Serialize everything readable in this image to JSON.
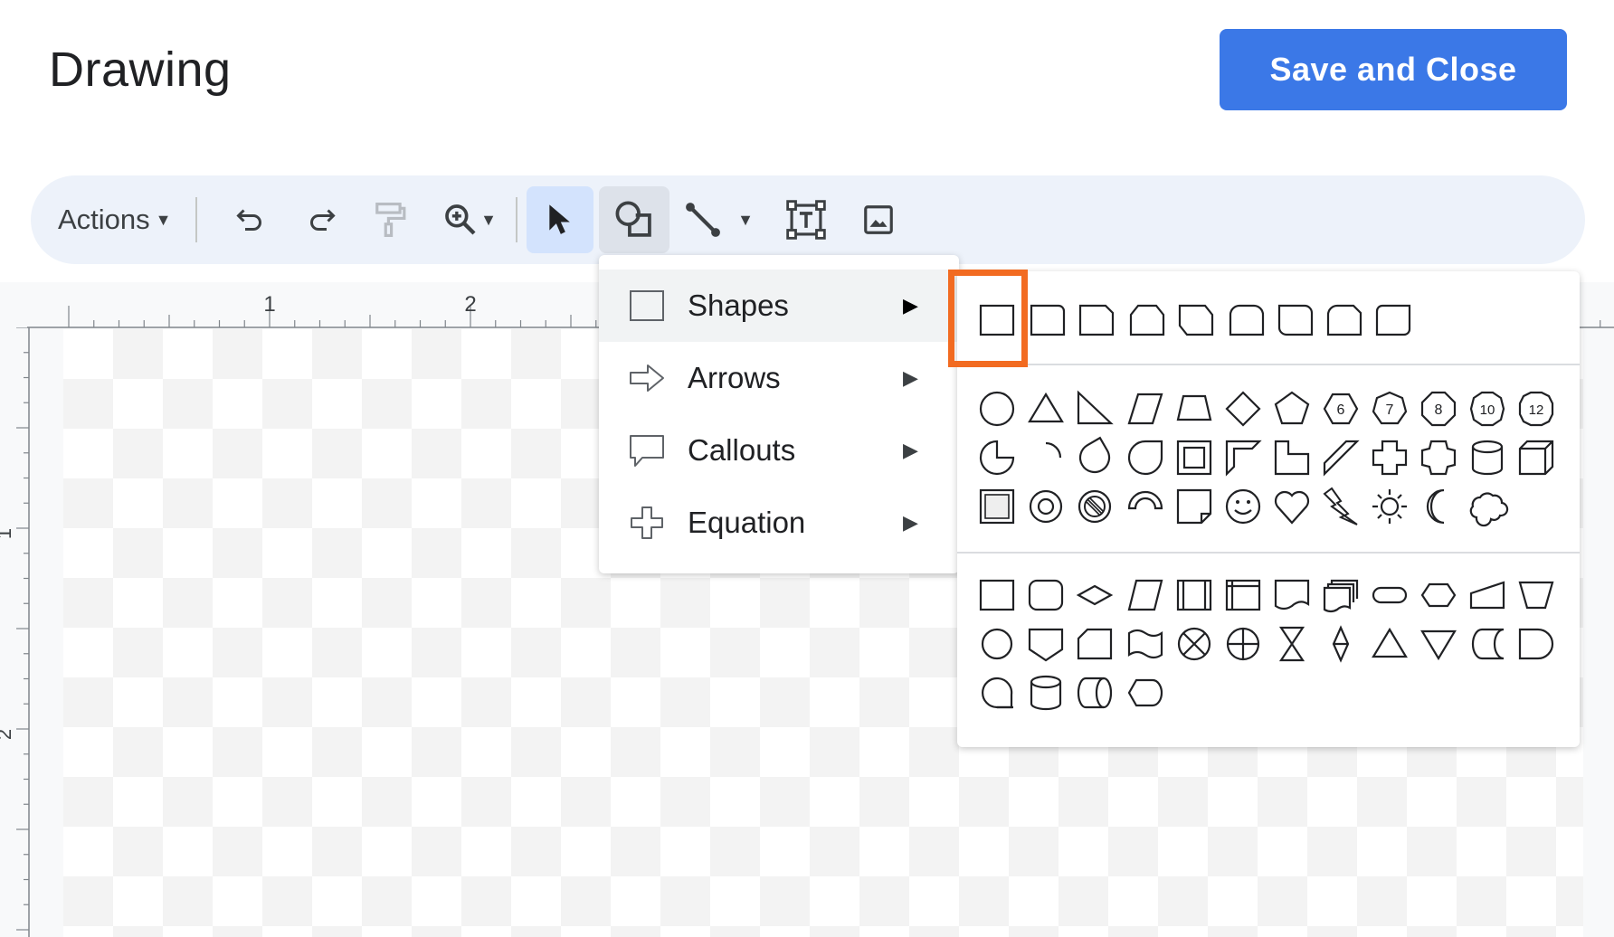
{
  "header": {
    "title": "Drawing",
    "save_button": "Save and Close"
  },
  "toolbar": {
    "actions_label": "Actions",
    "icons": [
      "undo-icon",
      "redo-icon",
      "paint-format-icon",
      "zoom-icon",
      "select-icon",
      "shape-icon",
      "line-icon",
      "text-box-icon",
      "image-icon"
    ]
  },
  "ruler": {
    "top_ticks": [
      "1",
      "2"
    ],
    "left_ticks": [
      "1",
      "2"
    ]
  },
  "menu": {
    "items": [
      {
        "label": "Shapes",
        "icon": "shapes-square-icon"
      },
      {
        "label": "Arrows",
        "icon": "arrow-right-icon"
      },
      {
        "label": "Callouts",
        "icon": "callout-icon"
      },
      {
        "label": "Equation",
        "icon": "plus-icon"
      }
    ]
  },
  "submenu": {
    "rows": [
      [
        "rectangle",
        "round-single-corner",
        "snip-single-corner",
        "snip-same-side",
        "snip-diagonal",
        "round-same-side",
        "round-diagonal",
        "snip-round-corner",
        "rounded-rectangle"
      ],
      [
        "ellipse",
        "triangle",
        "right-triangle",
        "parallelogram",
        "trapezoid",
        "diamond",
        "pentagon",
        "hexagon",
        "heptagon",
        "octagon",
        "decagon",
        "dodecagon"
      ],
      [
        "pie",
        "arc",
        "teardrop",
        "chord",
        "frame",
        "half-frame",
        "corner",
        "diagonal-stripe",
        "plus",
        "octagon-cross",
        "can",
        "cube"
      ],
      [
        "bevel",
        "donut",
        "no-symbol",
        "block-arc",
        "folded-corner",
        "smiley-face",
        "heart",
        "lightning-bolt",
        "sun",
        "moon",
        "cloud"
      ],
      [
        "flowchart-process",
        "flowchart-alternate-process",
        "flowchart-decision",
        "flowchart-data",
        "flowchart-predefined-process",
        "flowchart-internal-storage",
        "flowchart-document",
        "flowchart-multidocument",
        "flowchart-terminator",
        "flowchart-preparation",
        "flowchart-manual-input",
        "flowchart-manual-operation"
      ],
      [
        "flowchart-connector",
        "flowchart-offpage-connector",
        "flowchart-card",
        "flowchart-punched-tape",
        "flowchart-summing-junction",
        "flowchart-or",
        "flowchart-collate",
        "flowchart-sort",
        "flowchart-extract",
        "flowchart-merge",
        "flowchart-stored-data",
        "flowchart-delay"
      ],
      [
        "flowchart-sequential-access-storage",
        "flowchart-magnetic-disk",
        "flowchart-direct-access-storage",
        "flowchart-display"
      ]
    ],
    "hex_label": "6",
    "hept_label": "7",
    "oct_label": "8",
    "dec_label": "10",
    "dodec_label": "12"
  },
  "colors": {
    "accent": "#3b78e7",
    "highlight": "#f26b21"
  }
}
